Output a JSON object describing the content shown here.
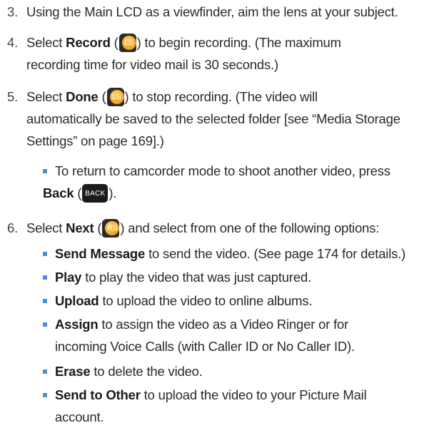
{
  "steps": [
    {
      "number": "3.",
      "lines": [
        {
          "text": "Using the Main LCD as a viewfinder, aim the lens at your subject."
        }
      ]
    },
    {
      "number": "4.",
      "bold": "Record",
      "key": "LS",
      "after": ") to begin recording. (The maximum",
      "line2": "recording time for video mail is 30 seconds.)"
    },
    {
      "number": "5.",
      "bold": "Done",
      "key": "LS",
      "after": ") to stop recording. (The video will",
      "line2": "automatically be saved to the selected folder [see “Media Storage",
      "line3": "Settings” on page 169].)"
    },
    {
      "number": "6.",
      "bold": "Next",
      "key": "RS",
      "after": ") and select from one of the following options:"
    }
  ],
  "select_word": "Select",
  "step5_sub": {
    "text": "To return to camcorder mode to shoot another video, press",
    "bold": "Back",
    "key": "BACK",
    "after": ")."
  },
  "options": [
    {
      "bold": "Send Message",
      "text": " to send the video. (See page 174 for details.)"
    },
    {
      "bold": "Play",
      "text": " to play the video that was just captured."
    },
    {
      "bold": "Upload",
      "text": " to upload the video to online albums."
    },
    {
      "bold": "Assign",
      "text": " to assign the video as a Video Ringer or for",
      "line2": "incoming Voice Calls (with Caller ID or No Caller ID)."
    },
    {
      "bold": "Erase",
      "text": " to delete the video."
    },
    {
      "bold": "Send to Other",
      "text": " to upload the video to your Picture Mail",
      "line2": "account."
    }
  ]
}
